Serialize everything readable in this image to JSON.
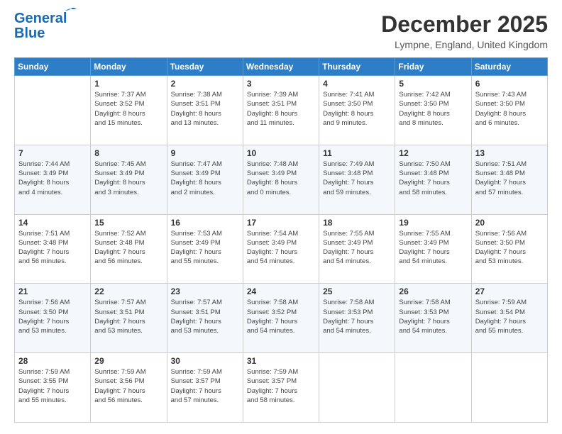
{
  "header": {
    "logo_line1": "General",
    "logo_line2": "Blue",
    "month": "December 2025",
    "location": "Lympne, England, United Kingdom"
  },
  "days_of_week": [
    "Sunday",
    "Monday",
    "Tuesday",
    "Wednesday",
    "Thursday",
    "Friday",
    "Saturday"
  ],
  "weeks": [
    [
      {
        "day": "",
        "sunrise": "",
        "sunset": "",
        "daylight": ""
      },
      {
        "day": "1",
        "sunrise": "Sunrise: 7:37 AM",
        "sunset": "Sunset: 3:52 PM",
        "daylight": "Daylight: 8 hours and 15 minutes."
      },
      {
        "day": "2",
        "sunrise": "Sunrise: 7:38 AM",
        "sunset": "Sunset: 3:51 PM",
        "daylight": "Daylight: 8 hours and 13 minutes."
      },
      {
        "day": "3",
        "sunrise": "Sunrise: 7:39 AM",
        "sunset": "Sunset: 3:51 PM",
        "daylight": "Daylight: 8 hours and 11 minutes."
      },
      {
        "day": "4",
        "sunrise": "Sunrise: 7:41 AM",
        "sunset": "Sunset: 3:50 PM",
        "daylight": "Daylight: 8 hours and 9 minutes."
      },
      {
        "day": "5",
        "sunrise": "Sunrise: 7:42 AM",
        "sunset": "Sunset: 3:50 PM",
        "daylight": "Daylight: 8 hours and 8 minutes."
      },
      {
        "day": "6",
        "sunrise": "Sunrise: 7:43 AM",
        "sunset": "Sunset: 3:50 PM",
        "daylight": "Daylight: 8 hours and 6 minutes."
      }
    ],
    [
      {
        "day": "7",
        "sunrise": "Sunrise: 7:44 AM",
        "sunset": "Sunset: 3:49 PM",
        "daylight": "Daylight: 8 hours and 4 minutes."
      },
      {
        "day": "8",
        "sunrise": "Sunrise: 7:45 AM",
        "sunset": "Sunset: 3:49 PM",
        "daylight": "Daylight: 8 hours and 3 minutes."
      },
      {
        "day": "9",
        "sunrise": "Sunrise: 7:47 AM",
        "sunset": "Sunset: 3:49 PM",
        "daylight": "Daylight: 8 hours and 2 minutes."
      },
      {
        "day": "10",
        "sunrise": "Sunrise: 7:48 AM",
        "sunset": "Sunset: 3:49 PM",
        "daylight": "Daylight: 8 hours and 0 minutes."
      },
      {
        "day": "11",
        "sunrise": "Sunrise: 7:49 AM",
        "sunset": "Sunset: 3:48 PM",
        "daylight": "Daylight: 7 hours and 59 minutes."
      },
      {
        "day": "12",
        "sunrise": "Sunrise: 7:50 AM",
        "sunset": "Sunset: 3:48 PM",
        "daylight": "Daylight: 7 hours and 58 minutes."
      },
      {
        "day": "13",
        "sunrise": "Sunrise: 7:51 AM",
        "sunset": "Sunset: 3:48 PM",
        "daylight": "Daylight: 7 hours and 57 minutes."
      }
    ],
    [
      {
        "day": "14",
        "sunrise": "Sunrise: 7:51 AM",
        "sunset": "Sunset: 3:48 PM",
        "daylight": "Daylight: 7 hours and 56 minutes."
      },
      {
        "day": "15",
        "sunrise": "Sunrise: 7:52 AM",
        "sunset": "Sunset: 3:48 PM",
        "daylight": "Daylight: 7 hours and 56 minutes."
      },
      {
        "day": "16",
        "sunrise": "Sunrise: 7:53 AM",
        "sunset": "Sunset: 3:49 PM",
        "daylight": "Daylight: 7 hours and 55 minutes."
      },
      {
        "day": "17",
        "sunrise": "Sunrise: 7:54 AM",
        "sunset": "Sunset: 3:49 PM",
        "daylight": "Daylight: 7 hours and 54 minutes."
      },
      {
        "day": "18",
        "sunrise": "Sunrise: 7:55 AM",
        "sunset": "Sunset: 3:49 PM",
        "daylight": "Daylight: 7 hours and 54 minutes."
      },
      {
        "day": "19",
        "sunrise": "Sunrise: 7:55 AM",
        "sunset": "Sunset: 3:49 PM",
        "daylight": "Daylight: 7 hours and 54 minutes."
      },
      {
        "day": "20",
        "sunrise": "Sunrise: 7:56 AM",
        "sunset": "Sunset: 3:50 PM",
        "daylight": "Daylight: 7 hours and 53 minutes."
      }
    ],
    [
      {
        "day": "21",
        "sunrise": "Sunrise: 7:56 AM",
        "sunset": "Sunset: 3:50 PM",
        "daylight": "Daylight: 7 hours and 53 minutes."
      },
      {
        "day": "22",
        "sunrise": "Sunrise: 7:57 AM",
        "sunset": "Sunset: 3:51 PM",
        "daylight": "Daylight: 7 hours and 53 minutes."
      },
      {
        "day": "23",
        "sunrise": "Sunrise: 7:57 AM",
        "sunset": "Sunset: 3:51 PM",
        "daylight": "Daylight: 7 hours and 53 minutes."
      },
      {
        "day": "24",
        "sunrise": "Sunrise: 7:58 AM",
        "sunset": "Sunset: 3:52 PM",
        "daylight": "Daylight: 7 hours and 54 minutes."
      },
      {
        "day": "25",
        "sunrise": "Sunrise: 7:58 AM",
        "sunset": "Sunset: 3:53 PM",
        "daylight": "Daylight: 7 hours and 54 minutes."
      },
      {
        "day": "26",
        "sunrise": "Sunrise: 7:58 AM",
        "sunset": "Sunset: 3:53 PM",
        "daylight": "Daylight: 7 hours and 54 minutes."
      },
      {
        "day": "27",
        "sunrise": "Sunrise: 7:59 AM",
        "sunset": "Sunset: 3:54 PM",
        "daylight": "Daylight: 7 hours and 55 minutes."
      }
    ],
    [
      {
        "day": "28",
        "sunrise": "Sunrise: 7:59 AM",
        "sunset": "Sunset: 3:55 PM",
        "daylight": "Daylight: 7 hours and 55 minutes."
      },
      {
        "day": "29",
        "sunrise": "Sunrise: 7:59 AM",
        "sunset": "Sunset: 3:56 PM",
        "daylight": "Daylight: 7 hours and 56 minutes."
      },
      {
        "day": "30",
        "sunrise": "Sunrise: 7:59 AM",
        "sunset": "Sunset: 3:57 PM",
        "daylight": "Daylight: 7 hours and 57 minutes."
      },
      {
        "day": "31",
        "sunrise": "Sunrise: 7:59 AM",
        "sunset": "Sunset: 3:57 PM",
        "daylight": "Daylight: 7 hours and 58 minutes."
      },
      {
        "day": "",
        "sunrise": "",
        "sunset": "",
        "daylight": ""
      },
      {
        "day": "",
        "sunrise": "",
        "sunset": "",
        "daylight": ""
      },
      {
        "day": "",
        "sunrise": "",
        "sunset": "",
        "daylight": ""
      }
    ]
  ]
}
